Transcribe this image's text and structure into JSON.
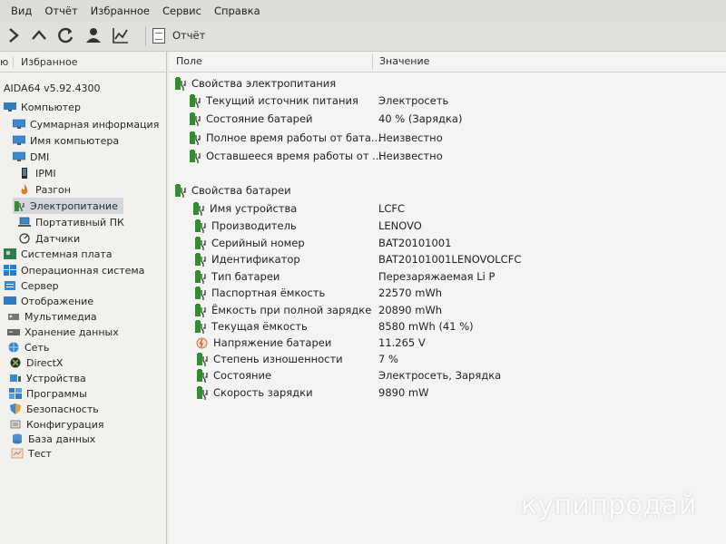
{
  "menu": [
    "Вид",
    "Отчёт",
    "Избранное",
    "Сервис",
    "Справка"
  ],
  "toolbar": {
    "icons": [
      "forward-icon",
      "up-icon",
      "refresh-icon",
      "user-icon",
      "chart-icon"
    ],
    "report_label": "Отчёт"
  },
  "left_panel": {
    "header_cut": "ю",
    "header_label": "Избранное",
    "tree": [
      {
        "label": "AIDA64 v5.92.4300",
        "icon": "none"
      },
      {
        "label": "Компьютер",
        "icon": "computer-icon"
      },
      {
        "label": "Суммарная информация",
        "icon": "monitor-icon"
      },
      {
        "label": "Имя компьютера",
        "icon": "monitor-icon"
      },
      {
        "label": "DMI",
        "icon": "monitor-icon"
      },
      {
        "label": "IPMI",
        "icon": "phone-icon"
      },
      {
        "label": "Разгон",
        "icon": "flame-icon"
      },
      {
        "label": "Электропитание",
        "icon": "battery-icon",
        "selected": true
      },
      {
        "label": "Портативный ПК",
        "icon": "laptop-icon"
      },
      {
        "label": "Датчики",
        "icon": "sensor-icon"
      },
      {
        "label": "Системная плата",
        "icon": "board-icon"
      },
      {
        "label": "Операционная система",
        "icon": "windows-icon"
      },
      {
        "label": "Сервер",
        "icon": "server-icon"
      },
      {
        "label": "Отображение",
        "icon": "display-icon"
      },
      {
        "label": "Мультимедиа",
        "icon": "media-icon"
      },
      {
        "label": "Хранение данных",
        "icon": "storage-icon"
      },
      {
        "label": "Сеть",
        "icon": "network-icon"
      },
      {
        "label": "DirectX",
        "icon": "xbox-icon"
      },
      {
        "label": "Устройства",
        "icon": "devices-icon"
      },
      {
        "label": "Программы",
        "icon": "programs-icon"
      },
      {
        "label": "Безопасность",
        "icon": "shield-icon"
      },
      {
        "label": "Конфигурация",
        "icon": "config-icon"
      },
      {
        "label": "База данных",
        "icon": "database-icon"
      },
      {
        "label": "Тест",
        "icon": "test-icon"
      }
    ]
  },
  "main": {
    "columns": {
      "field": "Поле",
      "value": "Значение"
    },
    "sections": [
      {
        "title": "Свойства электропитания",
        "rows": [
          {
            "field": "Текущий источник питания",
            "value": "Электросеть"
          },
          {
            "field": "Состояние батарей",
            "value": "40 % (Зарядка)"
          },
          {
            "field": "Полное время работы от бата...",
            "value": "Неизвестно"
          },
          {
            "field": "Оставшееся время работы от ...",
            "value": "Неизвестно"
          }
        ]
      },
      {
        "title": "Свойства батареи",
        "rows": [
          {
            "field": "Имя устройства",
            "value": "LCFC"
          },
          {
            "field": "Производитель",
            "value": "LENOVO"
          },
          {
            "field": "Серийный номер",
            "value": "BAT20101001"
          },
          {
            "field": "Идентификатор",
            "value": "BAT20101001LENOVOLCFC"
          },
          {
            "field": "Тип батареи",
            "value": "Перезаряжаемая Li P"
          },
          {
            "field": "Паспортная ёмкость",
            "value": "22570 mWh"
          },
          {
            "field": "Ёмкость при полной зарядке",
            "value": "20890 mWh"
          },
          {
            "field": "Текущая ёмкость",
            "value": "8580 mWh  (41 %)"
          },
          {
            "field": "Напряжение батареи",
            "value": "11.265 V",
            "icon": "voltage-icon"
          },
          {
            "field": "Степень изношенности",
            "value": "7 %"
          },
          {
            "field": "Состояние",
            "value": "Электросеть, Зарядка"
          },
          {
            "field": "Скорость зарядки",
            "value": "9890 mW"
          }
        ]
      }
    ]
  },
  "watermark": "купипродай",
  "colors": {
    "battery_green": "#2f8f2a",
    "selection": "#d4d8de",
    "background": "#f4f4f2"
  }
}
